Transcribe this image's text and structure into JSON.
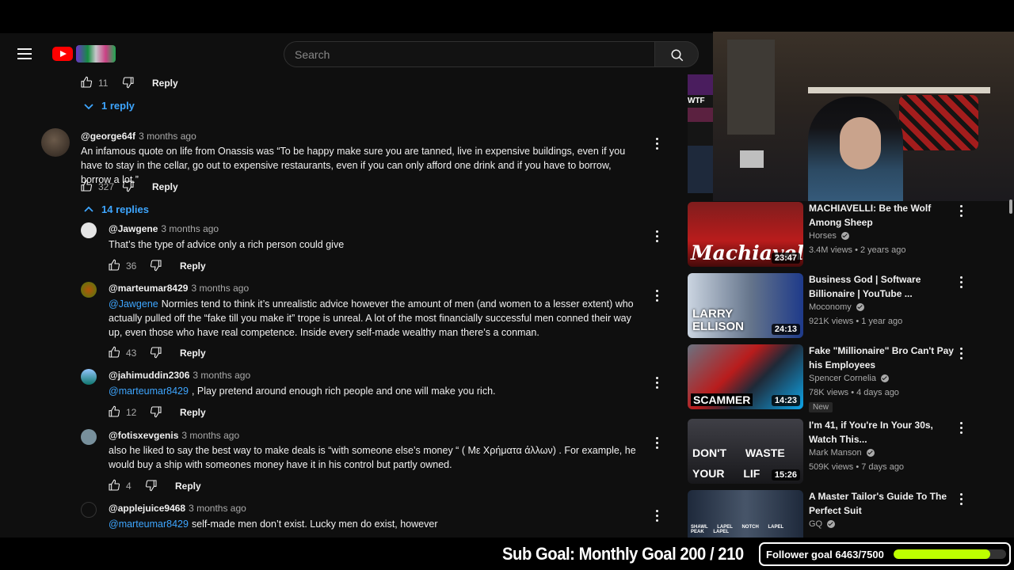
{
  "header": {
    "search_placeholder": "Search"
  },
  "comments": [
    {
      "type": "actions",
      "likes": "11",
      "reply_label": "Reply"
    },
    {
      "type": "toggle",
      "label": "1 reply",
      "expanded": false
    },
    {
      "type": "comment",
      "author": "@george64f",
      "time": "3 months ago",
      "text": "An infamous quote on life from Onassis was “To be happy make sure you are tanned, live in expensive buildings, even if you have to stay in the cellar, go out to expensive restaurants, even if you can only afford one drink and if you have to borrow, borrow a lot.”",
      "likes": "327",
      "reply_label": "Reply"
    },
    {
      "type": "toggle",
      "label": "14 replies",
      "expanded": true
    },
    {
      "type": "reply",
      "author": "@Jawgene",
      "time": "3 months ago",
      "mention": "",
      "text": "That’s the type of advice only a rich person could give",
      "likes": "36",
      "reply_label": "Reply"
    },
    {
      "type": "reply",
      "author": "@marteumar8429",
      "time": "3 months ago",
      "mention": "@Jawgene",
      "text": "Normies tend to think it’s unrealistic advice however the amount of men (and women to a lesser extent) who actually pulled off the “fake till you make it” trope is unreal. A lot of the most financially successful men conned their way up, even those who have real competence. Inside every self-made wealthy man there’s a conman.",
      "likes": "43",
      "reply_label": "Reply"
    },
    {
      "type": "reply",
      "author": "@jahimuddin2306",
      "time": "3 months ago",
      "mention": "@marteumar8429",
      "text": ", Play pretend around enough rich people and one will make you rich.",
      "likes": "12",
      "reply_label": "Reply"
    },
    {
      "type": "reply",
      "author": "@fotisxevgenis",
      "time": "3 months ago",
      "mention": "",
      "text": "also he liked to say the best way to make deals is “with someone else’s money “ ( Με Χρήματα άλλων) . For example, he would buy a ship with someones money have it in his control  but partly owned.",
      "likes": "4",
      "reply_label": "Reply"
    },
    {
      "type": "reply",
      "author": "@applejuice9468",
      "time": "3 months ago",
      "mention": "@marteumar8429",
      "text": "self-made men don’t exist. Lucky men do exist, however"
    }
  ],
  "recommendations": [
    {
      "title": "MACHIAVELLI: Be the Wolf Among Sheep",
      "channel": "Horses",
      "verified": true,
      "views": "3.4M views",
      "age": "2 years ago",
      "duration": "23:47",
      "thumb_text": "Machiavelli",
      "badge": ""
    },
    {
      "title": "Business God | Software Billionaire | YouTube ...",
      "channel": "Moconomy",
      "verified": true,
      "views": "921K views",
      "age": "1 year ago",
      "duration": "24:13",
      "thumb_text": "LARRY ELLISON",
      "badge": ""
    },
    {
      "title": "Fake \"Millionaire\" Bro Can't Pay his Employees",
      "channel": "Spencer Cornelia",
      "verified": true,
      "views": "78K views",
      "age": "4 days ago",
      "duration": "14:23",
      "thumb_text": "SCAMMER",
      "badge": "New"
    },
    {
      "title": "I'm 41, if You're In Your 30s, Watch This...",
      "channel": "Mark Manson",
      "verified": true,
      "views": "509K views",
      "age": "7 days ago",
      "duration": "15:26",
      "thumb_text": "DON'T WASTE YOUR LIF",
      "badge": ""
    },
    {
      "title": "A Master Tailor's Guide To The Perfect Suit",
      "channel": "GQ",
      "verified": true,
      "views": "",
      "age": "",
      "duration": "",
      "thumb_text": "SHAWL LAPEL  NOTCH LAPEL  PEAK LAPEL",
      "badge": ""
    }
  ],
  "webcam_overlay": {
    "sidebar_text": "WTF"
  },
  "stream_overlay": {
    "sub_goal": "Sub Goal: Monthly Goal  200 / 210",
    "follower_goal": "Follower goal 6463/7500",
    "follower_progress": 0.862
  },
  "colors": {
    "link": "#3ea6ff",
    "background": "#0f0f0f",
    "goal_bar": "#bdff00"
  }
}
